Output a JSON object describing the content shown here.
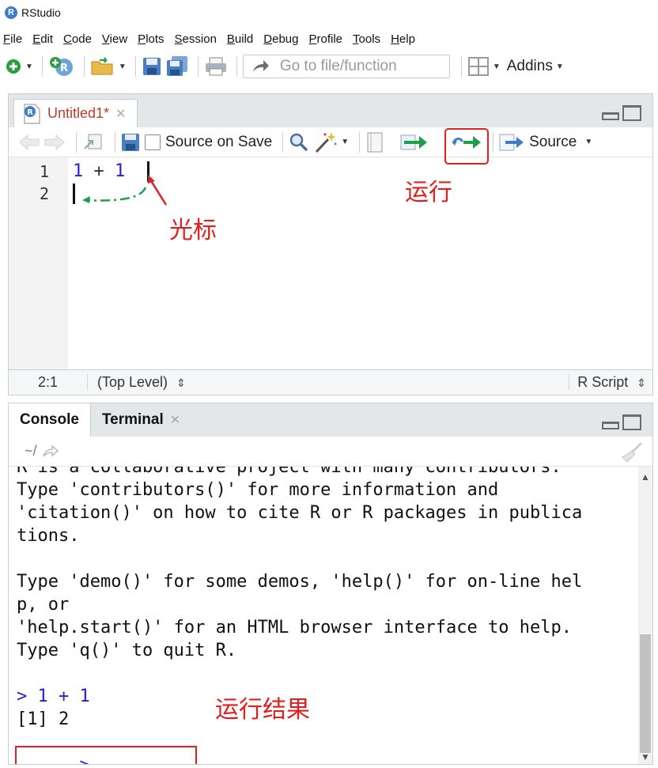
{
  "window": {
    "title": "RStudio"
  },
  "menus": [
    "File",
    "Edit",
    "Code",
    "View",
    "Plots",
    "Session",
    "Build",
    "Debug",
    "Profile",
    "Tools",
    "Help"
  ],
  "toolbar": {
    "goto_placeholder": "Go to file/function",
    "addins_label": "Addins"
  },
  "source": {
    "tab_title": "Untitled1*",
    "source_on_save_label": "Source on Save",
    "source_label": "Source",
    "line_numbers": [
      "1",
      "2"
    ],
    "code_line_1": {
      "left": "1",
      "op": "+",
      "right": "1"
    },
    "status": {
      "position": "2:1",
      "scope": "(Top Level)",
      "file_type": "R Script"
    }
  },
  "annotations": {
    "run": "运行",
    "cursor": "光标",
    "run_result": "运行结果"
  },
  "console": {
    "tabs": [
      {
        "label": "Console"
      },
      {
        "label": "Terminal"
      }
    ],
    "path": "~/",
    "lines": [
      "R is a collaborative project with many contributors.",
      "Type 'contributors()' for more information and",
      "'citation()' on how to cite R or R packages in publica",
      "tions.",
      "",
      "Type 'demo()' for some demos, 'help()' for on-line hel",
      "p, or",
      "'help.start()' for an HTML browser interface to help.",
      "Type 'q()' to quit R.",
      ""
    ],
    "input_line": "> 1 + 1",
    "output_line": "[1] 2",
    "prompt": ">"
  },
  "colors": {
    "accent_red": "#e02020",
    "code_blue": "#2320d6",
    "cursor_arrow_green": "#1e9e4a"
  }
}
